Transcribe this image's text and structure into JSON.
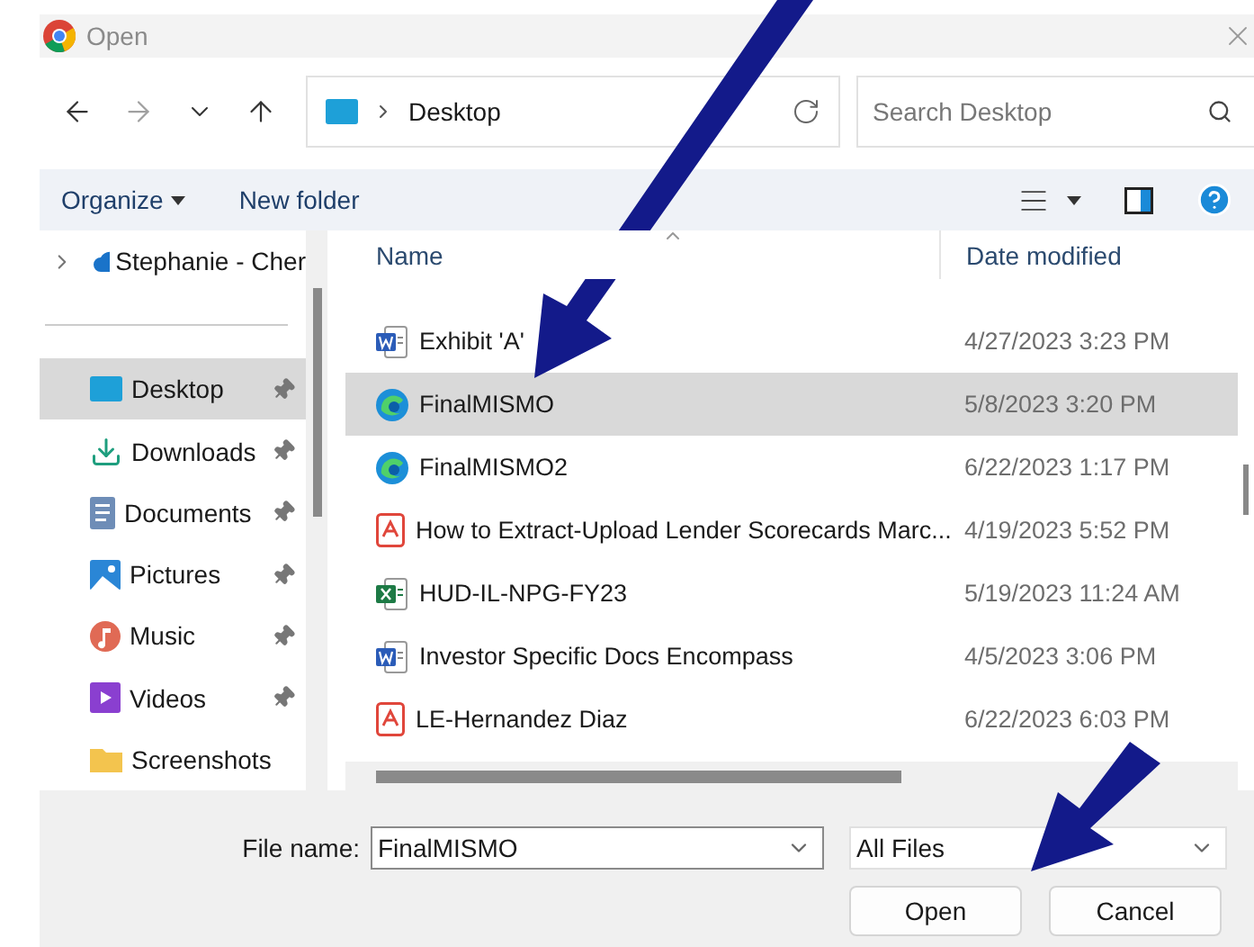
{
  "window": {
    "title": "Open"
  },
  "nav": {
    "path": "Desktop",
    "search_placeholder": "Search Desktop"
  },
  "commands": {
    "organize": "Organize",
    "new_folder": "New folder"
  },
  "sidebar": {
    "cloud": {
      "label": "Stephanie - Cher",
      "expanded": false
    },
    "items": [
      {
        "label": "Desktop",
        "kind": "desktop",
        "selected": true,
        "pinned": true
      },
      {
        "label": "Downloads",
        "kind": "downloads",
        "selected": false,
        "pinned": true
      },
      {
        "label": "Documents",
        "kind": "documents",
        "selected": false,
        "pinned": true
      },
      {
        "label": "Pictures",
        "kind": "pictures",
        "selected": false,
        "pinned": true
      },
      {
        "label": "Music",
        "kind": "music",
        "selected": false,
        "pinned": true
      },
      {
        "label": "Videos",
        "kind": "videos",
        "selected": false,
        "pinned": true
      },
      {
        "label": "Screenshots",
        "kind": "folder",
        "selected": false,
        "pinned": false
      }
    ]
  },
  "columns": [
    "Name",
    "Date modified"
  ],
  "files": [
    {
      "name": "Exhibit 'A'",
      "date": "4/27/2023 3:23 PM",
      "kind": "word",
      "selected": false
    },
    {
      "name": "FinalMISMO",
      "date": "5/8/2023 3:20 PM",
      "kind": "edge",
      "selected": true
    },
    {
      "name": "FinalMISMO2",
      "date": "6/22/2023 1:17 PM",
      "kind": "edge",
      "selected": false
    },
    {
      "name": "How to Extract-Upload Lender Scorecards Marc...",
      "date": "4/19/2023 5:52 PM",
      "kind": "pdf",
      "selected": false
    },
    {
      "name": "HUD-IL-NPG-FY23",
      "date": "5/19/2023 11:24 AM",
      "kind": "excel",
      "selected": false
    },
    {
      "name": "Investor Specific Docs Encompass",
      "date": "4/5/2023 3:06 PM",
      "kind": "word",
      "selected": false
    },
    {
      "name": "LE-Hernandez Diaz",
      "date": "6/22/2023 6:03 PM",
      "kind": "pdf",
      "selected": false
    }
  ],
  "footer": {
    "file_name_label": "File name:",
    "file_name": "FinalMISMO",
    "filter": "All Files",
    "buttons": [
      "Open",
      "Cancel"
    ]
  }
}
